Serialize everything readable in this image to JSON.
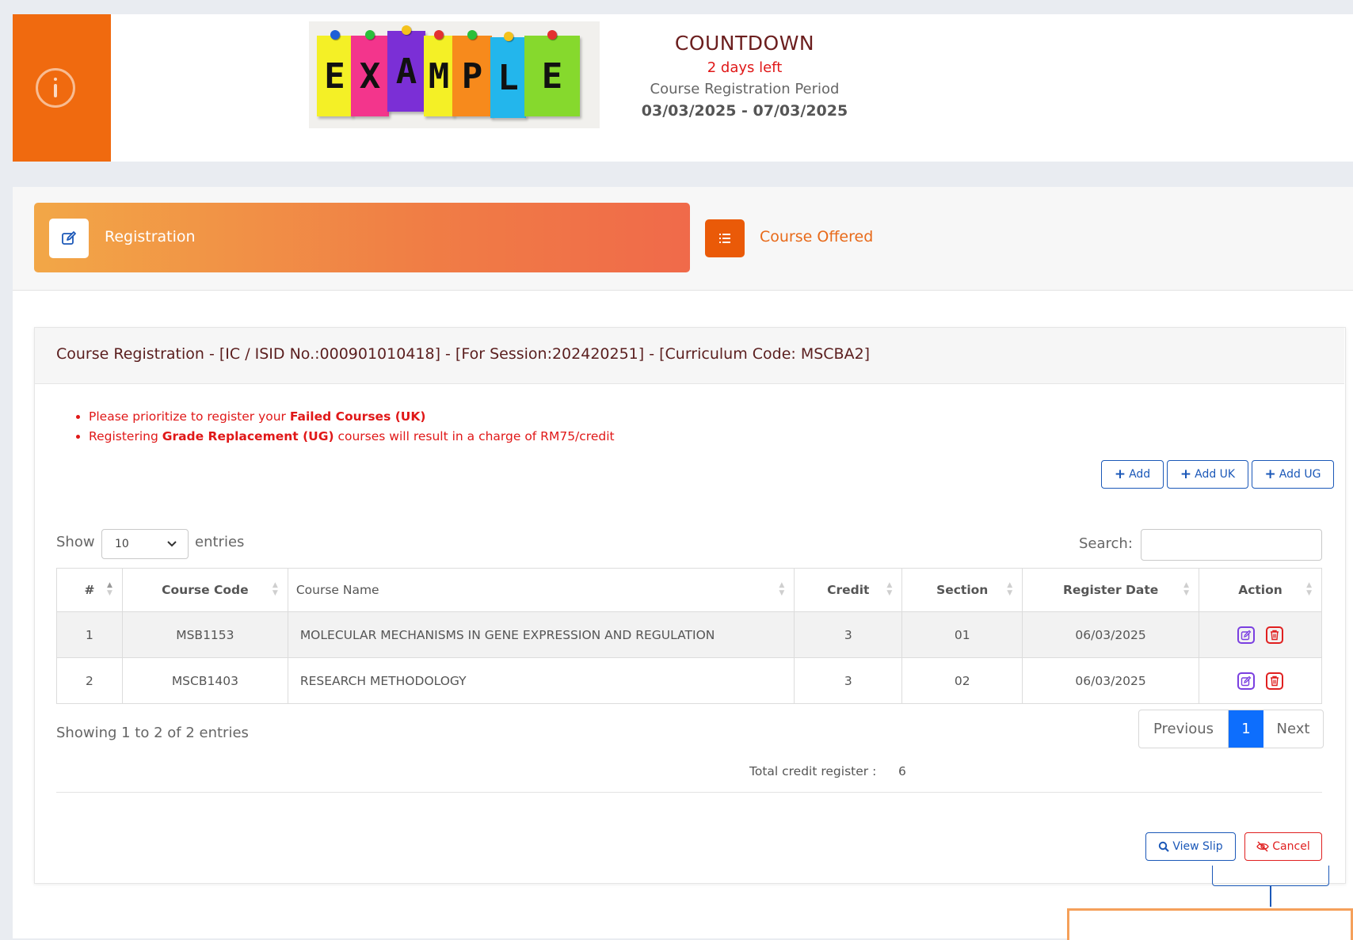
{
  "countdown": {
    "title": "COUNTDOWN",
    "days_left": "2 days left",
    "period_label": "Course Registration Period",
    "date_range": "03/03/2025 - 07/03/2025"
  },
  "logo": {
    "letters": [
      "E",
      "X",
      "A",
      "M",
      "P",
      "L",
      "E"
    ],
    "note_colors": [
      "#f4f026",
      "#f3358c",
      "#7b2fd6",
      "#f4f026",
      "#f78a1c",
      "#23b6ec",
      "#86d92d"
    ],
    "pin_colors": [
      "#1f5fd6",
      "#2bbf3a",
      "#f4c21c",
      "#e33030",
      "#2bbf3a",
      "#f4c21c",
      "#e33030"
    ]
  },
  "tabs": {
    "registration": "Registration",
    "course_offered": "Course Offered"
  },
  "card": {
    "title": "Course Registration - [IC / ISID No.:000901010418] - [For Session:202420251] - [Curriculum Code: MSCBA2]"
  },
  "notes": {
    "line1_pre": "Please prioritize to register your ",
    "line1_bold": "Failed Courses (UK)",
    "line2_pre": "Registering ",
    "line2_bold": "Grade Replacement (UG)",
    "line2_post": " courses will result in a charge of RM75/credit"
  },
  "buttons": {
    "add": "Add",
    "add_uk": "Add UK",
    "add_ug": "Add UG",
    "view_slip": "View Slip",
    "cancel": "Cancel"
  },
  "table_controls": {
    "show": "Show",
    "entries_value": "10",
    "entries": "entries",
    "search": "Search:"
  },
  "table": {
    "columns": [
      "#",
      "Course Code",
      "Course Name",
      "Credit",
      "Section",
      "Register Date",
      "Action"
    ],
    "rows": [
      {
        "no": "1",
        "code": "MSB1153",
        "name": "MOLECULAR MECHANISMS IN GENE EXPRESSION AND REGULATION",
        "credit": "3",
        "section": "01",
        "date": "06/03/2025"
      },
      {
        "no": "2",
        "code": "MSCB1403",
        "name": "RESEARCH METHODOLOGY",
        "credit": "3",
        "section": "02",
        "date": "06/03/2025"
      }
    ]
  },
  "footer": {
    "showing": "Showing 1 to 2 of 2 entries",
    "previous": "Previous",
    "page": "1",
    "next": "Next",
    "total_label": "Total credit register :",
    "total_value": "6"
  },
  "colors": {
    "accent_orange": "#f06a0f",
    "primary_blue": "#1b58b8",
    "danger_red": "#e02020",
    "page_blue": "#0d6efd"
  }
}
